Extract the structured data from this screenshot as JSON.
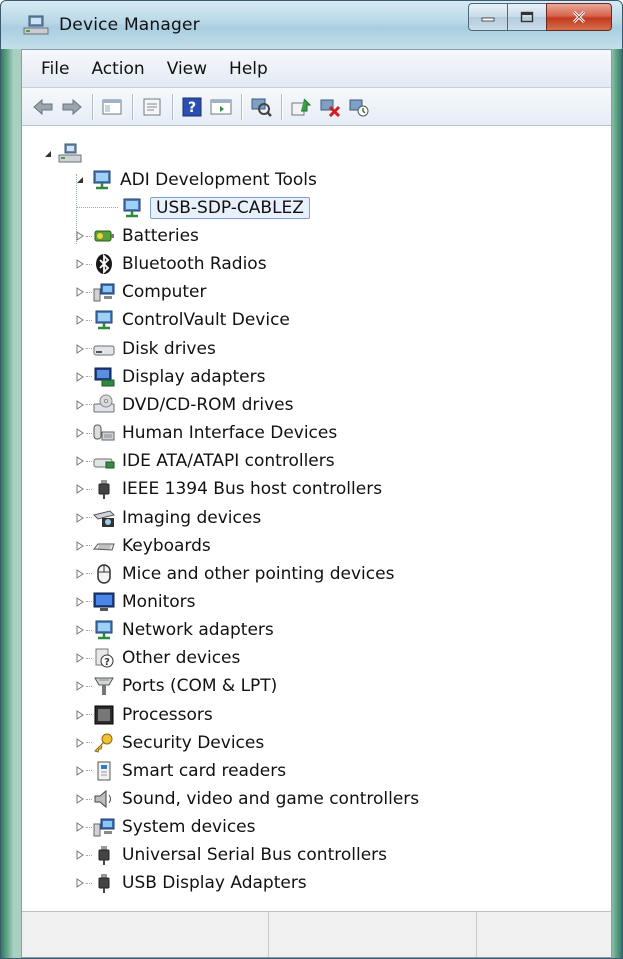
{
  "window": {
    "title": "Device Manager"
  },
  "menu": [
    "File",
    "Action",
    "View",
    "Help"
  ],
  "toolbar": {
    "buttons": [
      "back-icon",
      "forward-icon",
      "show-hide-tree-icon",
      "properties-icon",
      "help-icon",
      "action-pane-icon",
      "scan-hardware-icon",
      "update-driver-icon",
      "disable-device-icon",
      "uninstall-device-icon"
    ]
  },
  "tree": {
    "root_icon": "computer-root-icon",
    "adi": {
      "label": "ADI Development Tools",
      "child": "USB-SDP-CABLEZ"
    },
    "categories": [
      "Batteries",
      "Bluetooth Radios",
      "Computer",
      "ControlVault Device",
      "Disk drives",
      "Display adapters",
      "DVD/CD-ROM drives",
      "Human Interface Devices",
      "IDE ATA/ATAPI controllers",
      "IEEE 1394 Bus host controllers",
      "Imaging devices",
      "Keyboards",
      "Mice and other pointing devices",
      "Monitors",
      "Network adapters",
      "Other devices",
      "Ports (COM & LPT)",
      "Processors",
      "Security Devices",
      "Smart card readers",
      "Sound, video and game controllers",
      "System devices",
      "Universal Serial Bus controllers",
      "USB Display Adapters"
    ]
  },
  "colors": {
    "title_bar": "#b9d7e6",
    "close_button": "#c2391f",
    "selection_border": "#7da2ce"
  }
}
